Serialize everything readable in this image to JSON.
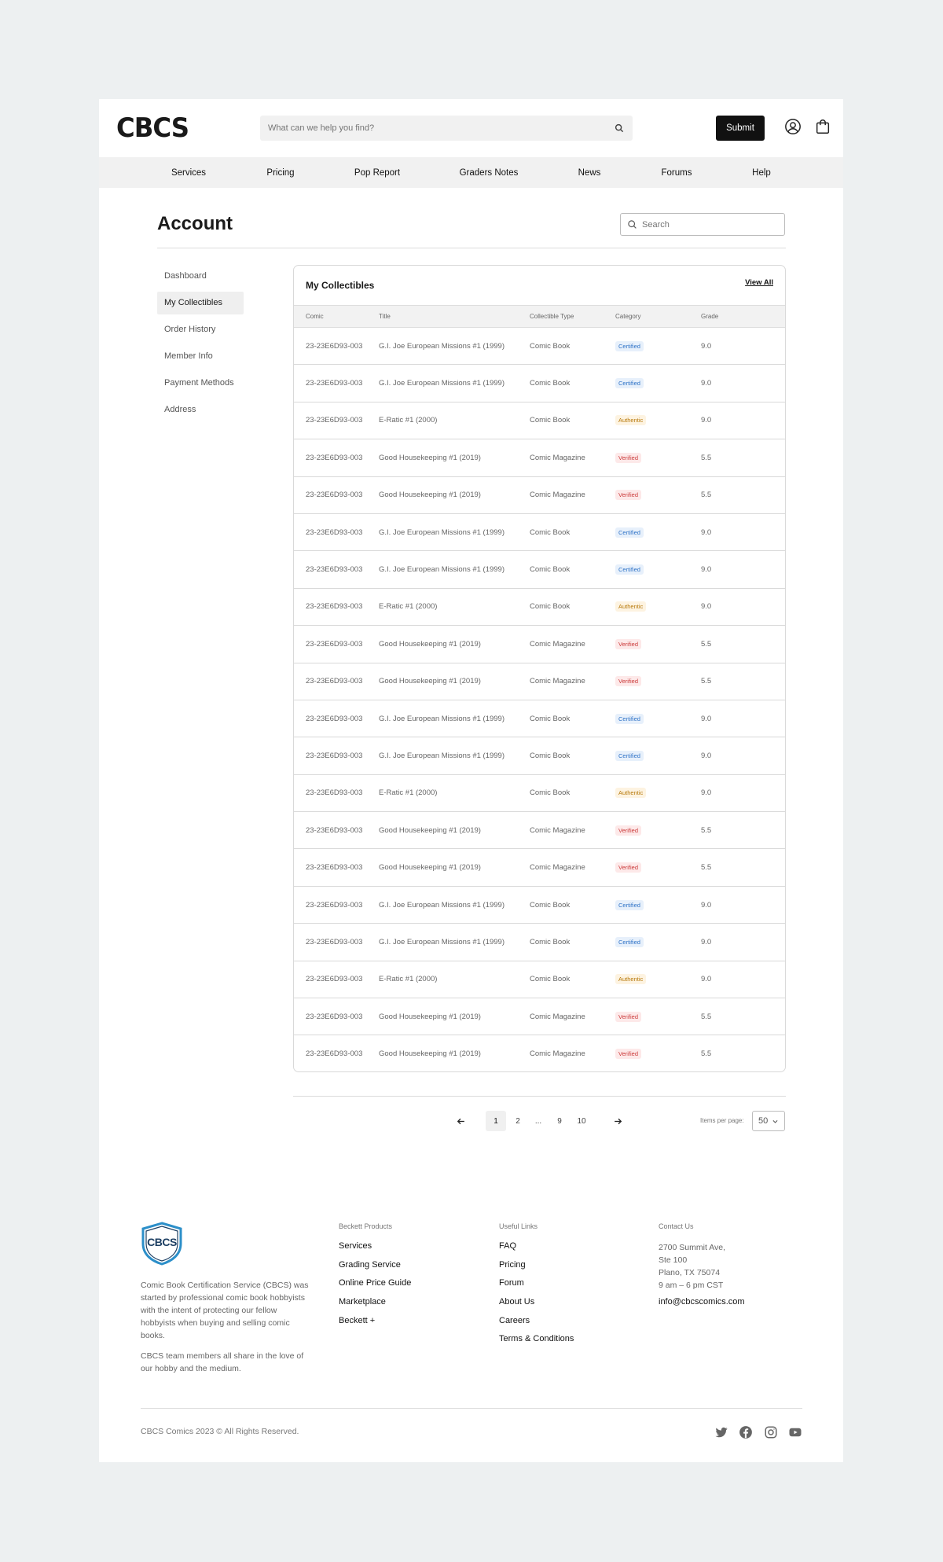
{
  "brand": {
    "logo": "CBCS"
  },
  "header": {
    "search_placeholder": "What can we help you find?",
    "submit_label": "Submit"
  },
  "nav": [
    "Services",
    "Pricing",
    "Pop Report",
    "Graders Notes",
    "News",
    "Forums",
    "Help"
  ],
  "account": {
    "title": "Account",
    "search_placeholder": "Search",
    "sidenav": [
      "Dashboard",
      "My Collectibles",
      "Order History",
      "Member Info",
      "Payment Methods",
      "Address"
    ],
    "active_item": "My Collectibles"
  },
  "collectibles": {
    "title": "My Collectibles",
    "view_all": "View All",
    "columns": [
      "Comic",
      "Title",
      "Collectible Type",
      "Category",
      "Grade"
    ],
    "rows": [
      {
        "comic": "23-23E6D93-003",
        "title": "G.I. Joe European Missions #1 (1999)",
        "type": "Comic Book",
        "category": "Certified",
        "grade": "9.0"
      },
      {
        "comic": "23-23E6D93-003",
        "title": "G.I. Joe European Missions #1 (1999)",
        "type": "Comic Book",
        "category": "Certified",
        "grade": "9.0"
      },
      {
        "comic": "23-23E6D93-003",
        "title": "E-Ratic #1 (2000)",
        "type": "Comic Book",
        "category": "Authentic",
        "grade": "9.0"
      },
      {
        "comic": "23-23E6D93-003",
        "title": "Good Housekeeping #1 (2019)",
        "type": "Comic Magazine",
        "category": "Verified",
        "grade": "5.5"
      },
      {
        "comic": "23-23E6D93-003",
        "title": "Good Housekeeping #1 (2019)",
        "type": "Comic Magazine",
        "category": "Verified",
        "grade": "5.5"
      },
      {
        "comic": "23-23E6D93-003",
        "title": "G.I. Joe European Missions #1 (1999)",
        "type": "Comic Book",
        "category": "Certified",
        "grade": "9.0"
      },
      {
        "comic": "23-23E6D93-003",
        "title": "G.I. Joe European Missions #1 (1999)",
        "type": "Comic Book",
        "category": "Certified",
        "grade": "9.0"
      },
      {
        "comic": "23-23E6D93-003",
        "title": "E-Ratic #1 (2000)",
        "type": "Comic Book",
        "category": "Authentic",
        "grade": "9.0"
      },
      {
        "comic": "23-23E6D93-003",
        "title": "Good Housekeeping #1 (2019)",
        "type": "Comic Magazine",
        "category": "Verified",
        "grade": "5.5"
      },
      {
        "comic": "23-23E6D93-003",
        "title": "Good Housekeeping #1 (2019)",
        "type": "Comic Magazine",
        "category": "Verified",
        "grade": "5.5"
      },
      {
        "comic": "23-23E6D93-003",
        "title": "G.I. Joe European Missions #1 (1999)",
        "type": "Comic Book",
        "category": "Certified",
        "grade": "9.0"
      },
      {
        "comic": "23-23E6D93-003",
        "title": "G.I. Joe European Missions #1 (1999)",
        "type": "Comic Book",
        "category": "Certified",
        "grade": "9.0"
      },
      {
        "comic": "23-23E6D93-003",
        "title": "E-Ratic #1 (2000)",
        "type": "Comic Book",
        "category": "Authentic",
        "grade": "9.0"
      },
      {
        "comic": "23-23E6D93-003",
        "title": "Good Housekeeping #1 (2019)",
        "type": "Comic Magazine",
        "category": "Verified",
        "grade": "5.5"
      },
      {
        "comic": "23-23E6D93-003",
        "title": "Good Housekeeping #1 (2019)",
        "type": "Comic Magazine",
        "category": "Verified",
        "grade": "5.5"
      },
      {
        "comic": "23-23E6D93-003",
        "title": "G.I. Joe European Missions #1 (1999)",
        "type": "Comic Book",
        "category": "Certified",
        "grade": "9.0"
      },
      {
        "comic": "23-23E6D93-003",
        "title": "G.I. Joe European Missions #1 (1999)",
        "type": "Comic Book",
        "category": "Certified",
        "grade": "9.0"
      },
      {
        "comic": "23-23E6D93-003",
        "title": "E-Ratic #1 (2000)",
        "type": "Comic Book",
        "category": "Authentic",
        "grade": "9.0"
      },
      {
        "comic": "23-23E6D93-003",
        "title": "Good Housekeeping #1 (2019)",
        "type": "Comic Magazine",
        "category": "Verified",
        "grade": "5.5"
      },
      {
        "comic": "23-23E6D93-003",
        "title": "Good Housekeeping #1 (2019)",
        "type": "Comic Magazine",
        "category": "Verified",
        "grade": "5.5"
      }
    ]
  },
  "pagination": {
    "pages": [
      "1",
      "2",
      "...",
      "9",
      "10"
    ],
    "current": "1",
    "per_page_label": "Items per page:",
    "per_page_value": "50"
  },
  "footer": {
    "logo_text": "CBCS",
    "about": [
      "Comic Book Certification Service (CBCS) was started by professional comic book hobbyists with the intent of protecting our fellow hobbyists when buying and selling comic books.",
      "CBCS team members all share in the love of our hobby and the medium."
    ],
    "beckett_heading": "Beckett Products",
    "beckett_links": [
      "Services",
      "Grading Service",
      "Online Price Guide",
      "Marketplace",
      "Beckett +"
    ],
    "useful_heading": "Useful Links",
    "useful_links": [
      "FAQ",
      "Pricing",
      "Forum",
      "About Us",
      "Careers",
      "Terms & Conditions"
    ],
    "contact_heading": "Contact Us",
    "contact_lines": [
      "2700 Summit Ave,",
      "Ste 100",
      "Plano, TX 75074",
      "9 am – 6 pm CST"
    ],
    "email": "info@cbcscomics.com",
    "copyright": "CBCS Comics 2023 © All Rights Reserved."
  },
  "colors": {
    "certified": "#2f73c7",
    "authentic": "#b7790b",
    "verified": "#cb3a3a",
    "shield": "#2c8fc9"
  },
  "icons": {
    "search": "search-icon",
    "user": "user-icon",
    "cart": "shopping-bag-icon",
    "prev": "arrow-left-icon",
    "next": "arrow-right-icon",
    "dropdown": "chevron-down-icon",
    "social": [
      "twitter-icon",
      "facebook-icon",
      "instagram-icon",
      "youtube-icon"
    ]
  }
}
